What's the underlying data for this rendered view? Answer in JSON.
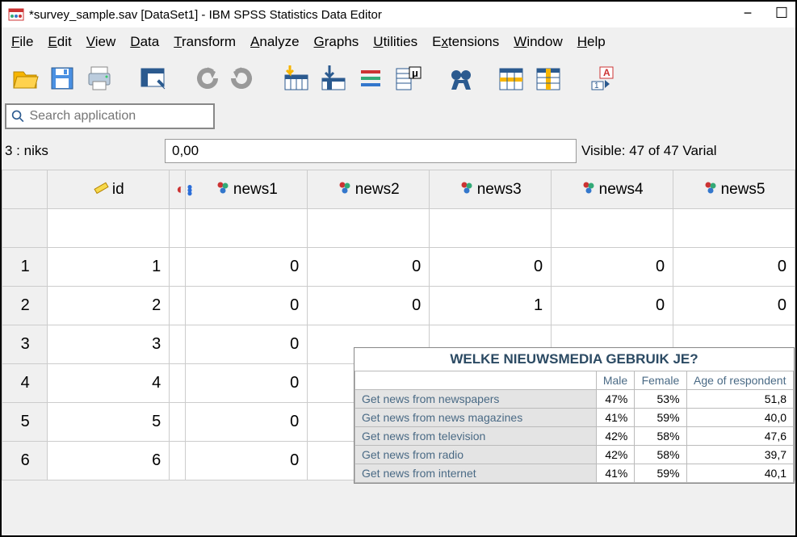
{
  "window": {
    "title": "*survey_sample.sav [DataSet1] - IBM SPSS Statistics Data Editor"
  },
  "menu": {
    "file": "File",
    "edit": "Edit",
    "view": "View",
    "data": "Data",
    "transform": "Transform",
    "analyze": "Analyze",
    "graphs": "Graphs",
    "utilities": "Utilities",
    "extensions": "Extensions",
    "window": "Window",
    "help": "Help"
  },
  "search": {
    "placeholder": "Search application"
  },
  "status": {
    "case_label": "3 : niks",
    "cell_value": "0,00",
    "visible": "Visible: 47 of 47 Varial"
  },
  "columns": {
    "id": "id",
    "news1": "news1",
    "news2": "news2",
    "news3": "news3",
    "news4": "news4",
    "news5": "news5"
  },
  "rows": {
    "r1": {
      "h": "1",
      "id": "1",
      "n1": "0",
      "n2": "0",
      "n3": "0",
      "n4": "0",
      "n5": "0"
    },
    "r2": {
      "h": "2",
      "id": "2",
      "n1": "0",
      "n2": "0",
      "n3": "1",
      "n4": "0",
      "n5": "0"
    },
    "r3": {
      "h": "3",
      "id": "3",
      "n1": "0",
      "n2": "",
      "n3": "",
      "n4": "",
      "n5": ""
    },
    "r4": {
      "h": "4",
      "id": "4",
      "n1": "0",
      "n2": "",
      "n3": "",
      "n4": "",
      "n5": ""
    },
    "r5": {
      "h": "5",
      "id": "5",
      "n1": "0",
      "n2": "",
      "n3": "",
      "n4": "",
      "n5": ""
    },
    "r6": {
      "h": "6",
      "id": "6",
      "n1": "0",
      "n2": "",
      "n3": "",
      "n4": "",
      "n5": ""
    }
  },
  "overlay": {
    "title": "WELKE NIEUWSMEDIA GEBRUIK JE?",
    "col_male": "Male",
    "col_female": "Female",
    "col_age": "Age of respondent",
    "r1": {
      "label": "Get news from newspapers",
      "male": "47%",
      "female": "53%",
      "age": "51,8"
    },
    "r2": {
      "label": "Get news from news magazines",
      "male": "41%",
      "female": "59%",
      "age": "40,0"
    },
    "r3": {
      "label": "Get news from television",
      "male": "42%",
      "female": "58%",
      "age": "47,6"
    },
    "r4": {
      "label": "Get news from radio",
      "male": "42%",
      "female": "58%",
      "age": "39,7"
    },
    "r5": {
      "label": "Get news from internet",
      "male": "41%",
      "female": "59%",
      "age": "40,1"
    }
  },
  "chart_data": {
    "type": "table",
    "title": "WELKE NIEUWSMEDIA GEBRUIK JE?",
    "columns": [
      "Male",
      "Female",
      "Age of respondent"
    ],
    "rows": [
      {
        "label": "Get news from newspapers",
        "values": [
          47,
          53,
          51.8
        ]
      },
      {
        "label": "Get news from news magazines",
        "values": [
          41,
          59,
          40.0
        ]
      },
      {
        "label": "Get news from television",
        "values": [
          42,
          58,
          47.6
        ]
      },
      {
        "label": "Get news from radio",
        "values": [
          42,
          58,
          39.7
        ]
      },
      {
        "label": "Get news from internet",
        "values": [
          41,
          59,
          40.1
        ]
      }
    ]
  }
}
